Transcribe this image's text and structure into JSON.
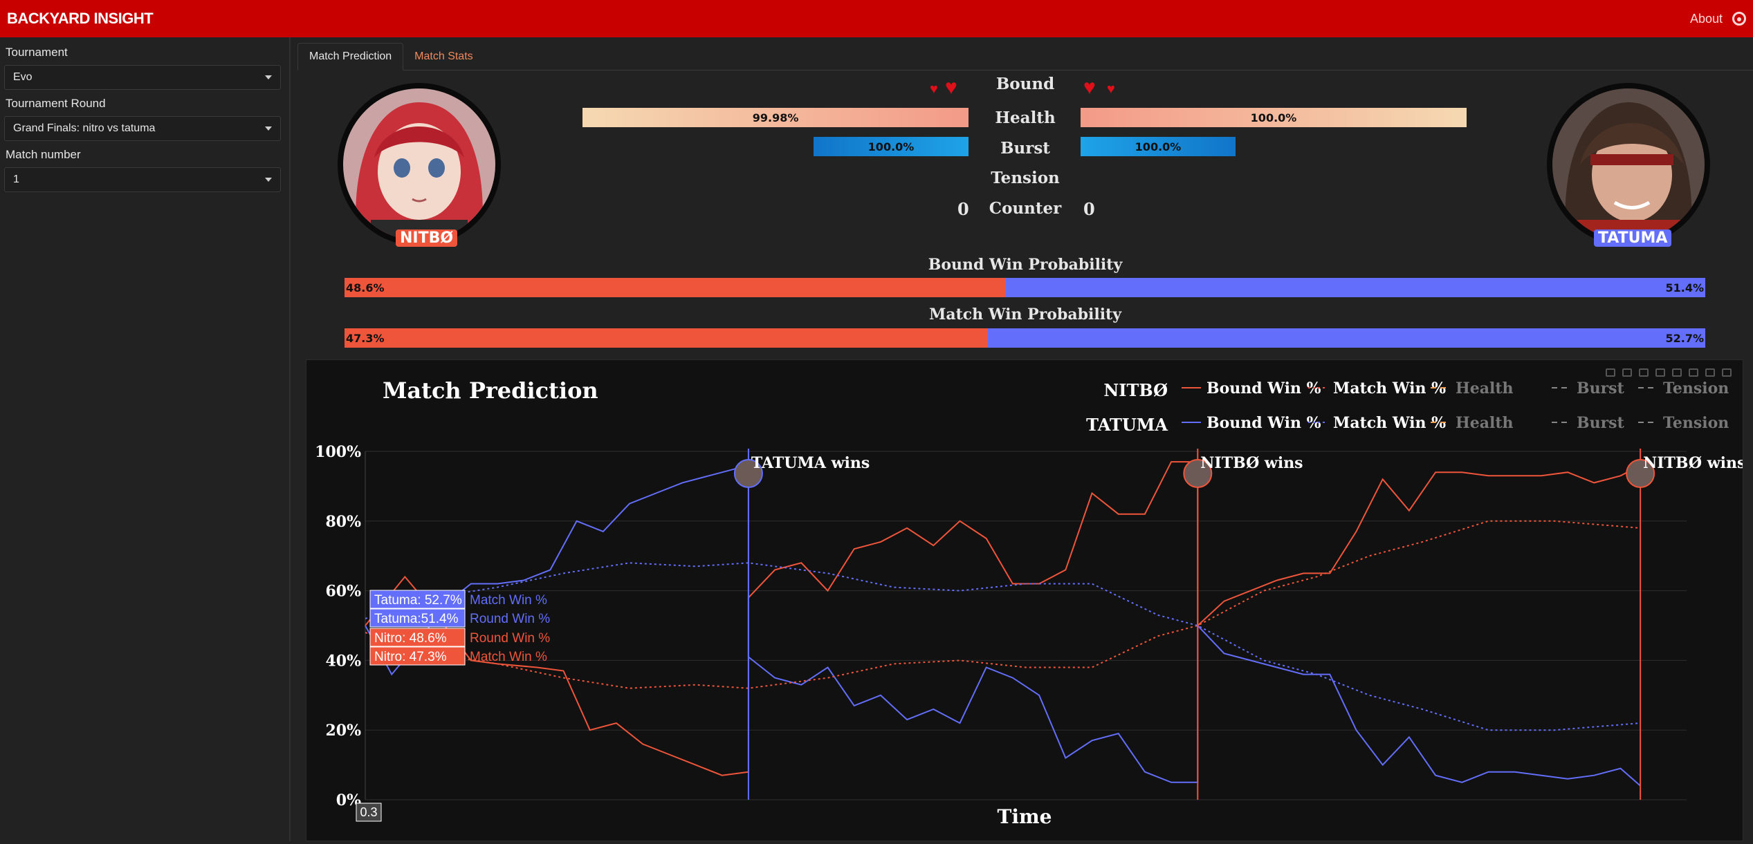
{
  "header": {
    "brand": "BACKYARD INSIGHT",
    "about": "About",
    "github_icon": "github-icon"
  },
  "sidebar": {
    "tournament_label": "Tournament",
    "tournament_value": "Evo",
    "round_label": "Tournament Round",
    "round_value": "Grand Finals: nitro vs tatuma",
    "match_label": "Match number",
    "match_value": "1"
  },
  "tabs": [
    {
      "label": "Match Prediction",
      "active": true
    },
    {
      "label": "Match Stats",
      "active": false
    }
  ],
  "players": {
    "left": {
      "name": "NITBØ",
      "color": "#ef553b",
      "health_text": "99.98%",
      "health": 0.9998,
      "burst_text": "100.0%",
      "burst": 1.0,
      "counter": "0",
      "round_hearts": 2
    },
    "right": {
      "name": "TATUMA",
      "color": "#636efa",
      "health_text": "100.0%",
      "health": 1.0,
      "burst_text": "100.0%",
      "burst": 1.0,
      "counter": "0",
      "round_hearts": 2
    }
  },
  "stats_labels": {
    "round": "Bound",
    "health": "Health",
    "burst": "Burst",
    "tension": "Tension",
    "counter": "Counter"
  },
  "round_win": {
    "title": "Bound Win Probability",
    "left_text": "48.6%",
    "right_text": "51.4%",
    "left": 0.486
  },
  "match_win": {
    "title": "Match Win Probability",
    "left_text": "47.3%",
    "right_text": "52.7%",
    "left": 0.473
  },
  "chart_data": {
    "type": "line",
    "title": "Match Prediction",
    "xlabel": "Time",
    "ylabel": "",
    "ylim": [
      0,
      100
    ],
    "yticks": [
      "0%",
      "20%",
      "40%",
      "60%",
      "80%",
      "100%"
    ],
    "legend": {
      "placement": "top-right",
      "rows": [
        {
          "player": "NITBØ",
          "entries": [
            "Bound Win %",
            "Match Win %",
            "Health",
            "Burst",
            "Tension"
          ]
        },
        {
          "player": "TATUMA",
          "entries": [
            "Bound Win %",
            "Match Win %",
            "Health",
            "Burst",
            "Tension"
          ]
        }
      ]
    },
    "events": [
      {
        "x": 0.29,
        "label": "TATUMA wins",
        "color": "#636efa"
      },
      {
        "x": 0.63,
        "label": "NITBØ wins",
        "color": "#ef553b"
      },
      {
        "x": 0.965,
        "label": "NITBØ wins",
        "color": "#ef553b"
      }
    ],
    "hover": {
      "x_label": "0.3",
      "items": [
        {
          "text": "Tatuma: 52.7%",
          "series": "Match Win %",
          "color": "#636efa"
        },
        {
          "text": "Tatuma:51.4%",
          "series": "Round Win %",
          "color": "#636efa"
        },
        {
          "text": "Nitro: 48.6%",
          "series": "Round Win %",
          "color": "#ef553b"
        },
        {
          "text": "Nitro: 47.3%",
          "series": "Match Win %",
          "color": "#ef553b"
        }
      ]
    },
    "series": [
      {
        "name": "Nitro Bound Win %",
        "color": "#ef553b",
        "dash": "solid",
        "x": [
          0,
          0.03,
          0.05,
          0.08,
          0.1,
          0.13,
          0.15,
          0.17,
          0.19,
          0.21,
          0.23,
          0.25,
          0.27,
          0.29,
          0.29,
          0.31,
          0.33,
          0.35,
          0.37,
          0.39,
          0.41,
          0.43,
          0.45,
          0.47,
          0.49,
          0.51,
          0.53,
          0.55,
          0.57,
          0.59,
          0.61,
          0.63,
          0.63,
          0.65,
          0.67,
          0.69,
          0.71,
          0.73,
          0.75,
          0.77,
          0.79,
          0.81,
          0.83,
          0.85,
          0.87,
          0.89,
          0.91,
          0.93,
          0.95,
          0.965
        ],
        "y": [
          50,
          64,
          55,
          40,
          39,
          38,
          37,
          20,
          22,
          16,
          13,
          10,
          7,
          8,
          58,
          66,
          68,
          60,
          72,
          74,
          78,
          73,
          80,
          75,
          62,
          62,
          66,
          88,
          82,
          82,
          97,
          97,
          50,
          57,
          60,
          63,
          65,
          65,
          77,
          92,
          83,
          94,
          94,
          93,
          93,
          93,
          94,
          91,
          93,
          96
        ]
      },
      {
        "name": "Tatuma Bound Win %",
        "color": "#636efa",
        "dash": "solid",
        "x": [
          0,
          0.02,
          0.04,
          0.06,
          0.08,
          0.1,
          0.12,
          0.14,
          0.16,
          0.18,
          0.2,
          0.22,
          0.24,
          0.26,
          0.28,
          0.29,
          0.29,
          0.31,
          0.33,
          0.35,
          0.37,
          0.39,
          0.41,
          0.43,
          0.45,
          0.47,
          0.49,
          0.51,
          0.53,
          0.55,
          0.57,
          0.59,
          0.61,
          0.63,
          0.63,
          0.65,
          0.67,
          0.69,
          0.71,
          0.73,
          0.75,
          0.77,
          0.79,
          0.81,
          0.83,
          0.85,
          0.87,
          0.89,
          0.91,
          0.93,
          0.95,
          0.965
        ],
        "y": [
          50,
          36,
          45,
          56,
          62,
          62,
          63,
          66,
          80,
          77,
          85,
          88,
          91,
          93,
          95,
          95,
          41,
          35,
          33,
          38,
          27,
          30,
          23,
          26,
          22,
          38,
          35,
          30,
          12,
          17,
          19,
          8,
          5,
          5,
          50,
          42,
          40,
          38,
          36,
          36,
          20,
          10,
          18,
          7,
          5,
          8,
          8,
          7,
          6,
          7,
          9,
          4
        ]
      },
      {
        "name": "Nitro Match Win %",
        "color": "#ef553b",
        "dash": "dot",
        "x": [
          0,
          0.05,
          0.1,
          0.15,
          0.2,
          0.25,
          0.29,
          0.35,
          0.4,
          0.45,
          0.5,
          0.55,
          0.6,
          0.63,
          0.68,
          0.72,
          0.76,
          0.8,
          0.85,
          0.9,
          0.965
        ],
        "y": [
          48,
          42,
          39,
          35,
          32,
          33,
          32,
          35,
          39,
          40,
          38,
          38,
          47,
          50,
          60,
          64,
          70,
          74,
          80,
          80,
          78
        ]
      },
      {
        "name": "Tatuma Match Win %",
        "color": "#636efa",
        "dash": "dot",
        "x": [
          0,
          0.05,
          0.1,
          0.15,
          0.2,
          0.25,
          0.29,
          0.35,
          0.4,
          0.45,
          0.5,
          0.55,
          0.6,
          0.63,
          0.68,
          0.72,
          0.76,
          0.8,
          0.85,
          0.9,
          0.965
        ],
        "y": [
          52,
          58,
          61,
          65,
          68,
          67,
          68,
          65,
          61,
          60,
          62,
          62,
          53,
          50,
          40,
          36,
          30,
          26,
          20,
          20,
          22
        ]
      }
    ]
  }
}
